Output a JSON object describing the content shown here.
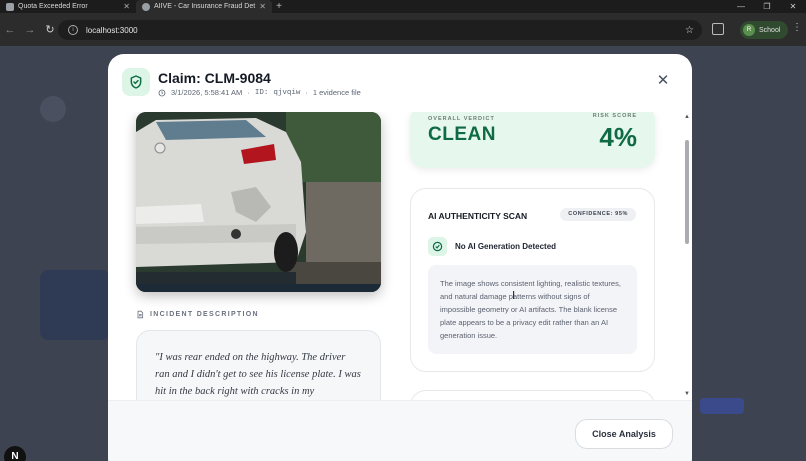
{
  "browser": {
    "tabs": [
      {
        "label": "Quota Exceeded Error"
      },
      {
        "label": "AIIVE - Car Insurance Fraud Det"
      }
    ],
    "url": "localhost:3000",
    "profile": {
      "initial": "R",
      "label": "School"
    }
  },
  "modal": {
    "title": "Claim: CLM-9084",
    "timestamp": "3/1/2026, 5:58:41 AM",
    "id_label": "ID:",
    "id_value": "qjvqiw",
    "evidence_count": "1 evidence file",
    "separator": "·",
    "incident_label": "INCIDENT DESCRIPTION",
    "incident_text": "\"I was rear ended on the highway. The driver ran and I didn't get to see his license plate. I was hit in the back right with cracks in my",
    "verdict": {
      "label": "OVERALL VERDICT",
      "value": "CLEAN",
      "risk_label": "RISK SCORE",
      "risk_value": "4%"
    },
    "ai_scan": {
      "title": "AI AUTHENTICITY SCAN",
      "confidence": "CONFIDENCE: 95%",
      "result": "No AI Generation Detected",
      "explanation": "The image shows consistent lighting, realistic textures, and natural damage patterns without signs of impossible geometry or AI artifacts. The blank license plate appears to be a privacy edit rather than an AI generation issue."
    },
    "close_button": "Close Analysis"
  },
  "overlay_badge": "N",
  "colors": {
    "clean_green": "#0f6b43",
    "verdict_bg": "#e6f7ee",
    "icon_bg": "#dcf5e6"
  }
}
